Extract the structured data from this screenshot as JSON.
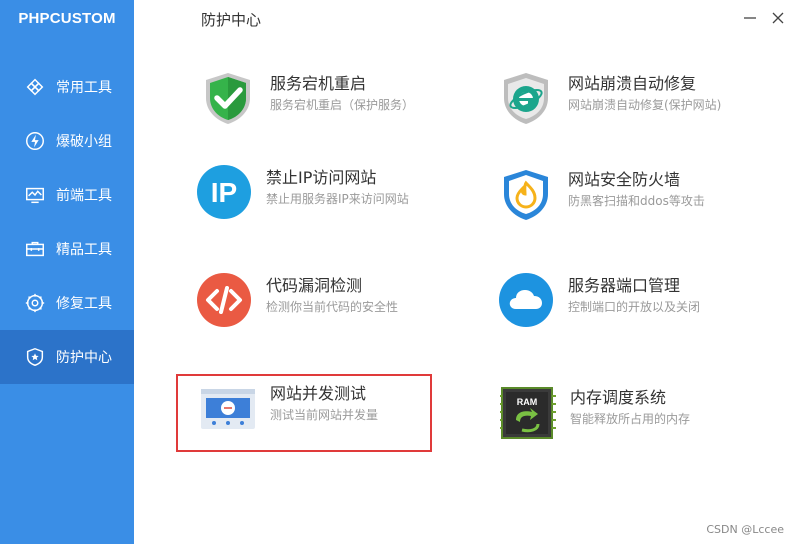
{
  "app": {
    "brand": "PHPCUSTOM"
  },
  "sidebar": {
    "items": [
      {
        "label": "常用工具",
        "icon": "tools-icon"
      },
      {
        "label": "爆破小组",
        "icon": "lightning-icon"
      },
      {
        "label": "前端工具",
        "icon": "monitor-icon"
      },
      {
        "label": "精品工具",
        "icon": "toolbox-icon"
      },
      {
        "label": "修复工具",
        "icon": "gear-wrench-icon"
      },
      {
        "label": "防护中心",
        "icon": "shield-star-icon",
        "active": true
      }
    ]
  },
  "header": {
    "title": "防护中心"
  },
  "tiles": [
    {
      "title": "服务宕机重启",
      "subtitle": "服务宕机重启（保护服务）",
      "icon": "green-shield-check-icon"
    },
    {
      "title": "网站崩溃自动修复",
      "subtitle": "网站崩溃自动修复(保护网站)",
      "icon": "ie-shield-icon"
    },
    {
      "title": "禁止IP访问网站",
      "subtitle": "禁止用服务器IP来访问网站",
      "icon": "ip-badge-icon"
    },
    {
      "title": "网站安全防火墙",
      "subtitle": "防黑客扫描和ddos等攻击",
      "icon": "fire-shield-icon"
    },
    {
      "title": "代码漏洞检测",
      "subtitle": "检测你当前代码的安全性",
      "icon": "code-icon"
    },
    {
      "title": "服务器端口管理",
      "subtitle": "控制端口的开放以及关闭",
      "icon": "cloud-icon"
    },
    {
      "title": "网站并发测试",
      "subtitle": "测试当前网站并发量",
      "icon": "speed-test-icon"
    },
    {
      "title": "内存调度系统",
      "subtitle": "智能释放所占用的内存",
      "icon": "ram-chip-icon",
      "chip_text": "RAM"
    }
  ],
  "watermark": "CSDN @Lccee",
  "colors": {
    "sidebar": "#3a8ee6",
    "sidebar_active": "#2c73c9",
    "highlight": "#e03a3a"
  }
}
